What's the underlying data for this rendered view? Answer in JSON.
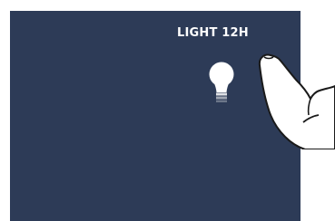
{
  "light_control": {
    "label": "LIGHT 12H",
    "icon": "lightbulb-icon"
  },
  "colors": {
    "screen_background": "#2d3b57",
    "page_background": "#ffffff",
    "label_color": "#ffffff",
    "bulb_color": "#ffffff"
  },
  "overlay": {
    "icon": "pointing-hand-icon"
  }
}
